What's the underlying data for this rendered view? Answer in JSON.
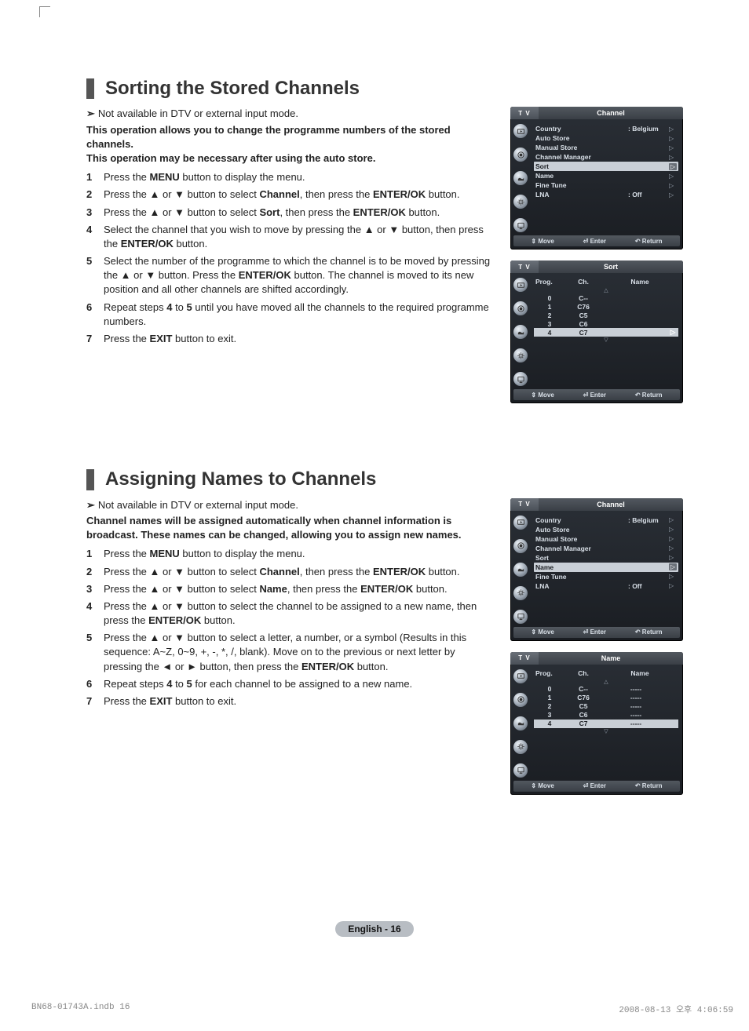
{
  "page": {
    "lang_badge": "English - 16",
    "doc_file": "BN68-01743A.indb   16",
    "doc_timestamp": "2008-08-13   오후 4:06:59"
  },
  "glyph": {
    "up": "▲",
    "down": "▼",
    "left": "◄",
    "right": "►",
    "tri_r": "▷",
    "tri_u": "△",
    "tri_d": "▽",
    "updown": "⇕",
    "enter": "⏎",
    "return": "↶",
    "note_arrow": "➢"
  },
  "section1": {
    "heading": "Sorting the Stored Channels",
    "note": "Not available in DTV or external input mode.",
    "intro1": "This operation allows you to change the programme numbers of the stored channels.",
    "intro2": "This operation may be necessary after using the auto store.",
    "steps": [
      {
        "n": "1",
        "parts": [
          "Press the ",
          {
            "b": "MENU"
          },
          " button to display the menu."
        ]
      },
      {
        "n": "2",
        "parts": [
          "Press the ▲ or ▼ button to select ",
          {
            "b": "Channel"
          },
          ", then press the ",
          {
            "b": "ENTER/OK"
          },
          " button."
        ]
      },
      {
        "n": "3",
        "parts": [
          "Press the ▲ or ▼ button to select ",
          {
            "b": "Sort"
          },
          ", then press the ",
          {
            "b": "ENTER/OK"
          },
          " button."
        ]
      },
      {
        "n": "4",
        "parts": [
          "Select the channel that you wish to move by pressing the ▲ or ▼ button, then press the ",
          {
            "b": "ENTER/OK"
          },
          " button."
        ]
      },
      {
        "n": "5",
        "parts": [
          "Select the number of the programme to which the channel is to be moved by pressing the ▲ or ▼ button. Press the ",
          {
            "b": "ENTER/OK"
          },
          " button. The channel is moved to its new position and all other channels are shifted accordingly."
        ]
      },
      {
        "n": "6",
        "parts": [
          "Repeat steps ",
          {
            "b": "4"
          },
          " to ",
          {
            "b": "5"
          },
          " until you have moved all the channels to the required programme numbers."
        ]
      },
      {
        "n": "7",
        "parts": [
          "Press the ",
          {
            "b": "EXIT"
          },
          " button to exit."
        ]
      }
    ]
  },
  "section2": {
    "heading": "Assigning Names to Channels",
    "note": "Not available in DTV or external input mode.",
    "intro1": "Channel names will be assigned automatically when channel information is broadcast. These names can be changed, allowing you to assign new names.",
    "steps": [
      {
        "n": "1",
        "parts": [
          "Press the ",
          {
            "b": "MENU"
          },
          " button to display the menu."
        ]
      },
      {
        "n": "2",
        "parts": [
          "Press the ▲ or ▼ button to select ",
          {
            "b": "Channel"
          },
          ", then press the ",
          {
            "b": "ENTER/OK"
          },
          " button."
        ]
      },
      {
        "n": "3",
        "parts": [
          "Press the ▲ or ▼ button to select ",
          {
            "b": "Name"
          },
          ", then press the ",
          {
            "b": "ENTER/OK"
          },
          " button."
        ]
      },
      {
        "n": "4",
        "parts": [
          "Press the ▲ or ▼ button to select the channel to be assigned to a new name, then press the ",
          {
            "b": "ENTER/OK"
          },
          " button."
        ]
      },
      {
        "n": "5",
        "parts": [
          "Press the ▲ or ▼ button to select a letter, a number, or a symbol (Results in this sequence: A~Z, 0~9, +, -, *, /, blank). Move on to the previous or next letter by pressing the ◄ or ► button, then press the ",
          {
            "b": "ENTER/OK"
          },
          " button."
        ]
      },
      {
        "n": "6",
        "parts": [
          "Repeat steps ",
          {
            "b": "4"
          },
          " to ",
          {
            "b": "5"
          },
          " for each channel to be assigned to a new name."
        ]
      },
      {
        "n": "7",
        "parts": [
          "Press the ",
          {
            "b": "EXIT"
          },
          " button to exit."
        ]
      }
    ]
  },
  "osd": {
    "tab": "T V",
    "foot_move": "Move",
    "foot_enter": "Enter",
    "foot_return": "Return",
    "channel_menu": {
      "title": "Channel",
      "items": [
        {
          "label": "Country",
          "val": ": Belgium"
        },
        {
          "label": "Auto Store",
          "val": ""
        },
        {
          "label": "Manual Store",
          "val": ""
        },
        {
          "label": "Channel Manager",
          "val": ""
        },
        {
          "label": "Sort",
          "val": ""
        },
        {
          "label": "Name",
          "val": ""
        },
        {
          "label": "Fine Tune",
          "val": ""
        },
        {
          "label": "LNA",
          "val": ": Off"
        }
      ],
      "selected_sort_idx": 4,
      "selected_name_idx": 5
    },
    "sort_screen": {
      "title": "Sort",
      "cols": {
        "c1": "Prog.",
        "c2": "Ch.",
        "c3": "Name"
      },
      "rows": [
        {
          "prog": "0",
          "ch": "C--",
          "name": ""
        },
        {
          "prog": "1",
          "ch": "C76",
          "name": ""
        },
        {
          "prog": "2",
          "ch": "C5",
          "name": ""
        },
        {
          "prog": "3",
          "ch": "C6",
          "name": ""
        },
        {
          "prog": "4",
          "ch": "C7",
          "name": ""
        }
      ],
      "selected_idx": 4
    },
    "name_screen": {
      "title": "Name",
      "cols": {
        "c1": "Prog.",
        "c2": "Ch.",
        "c3": "Name"
      },
      "rows": [
        {
          "prog": "0",
          "ch": "C--",
          "name": "-----"
        },
        {
          "prog": "1",
          "ch": "C76",
          "name": "-----"
        },
        {
          "prog": "2",
          "ch": "C5",
          "name": "-----"
        },
        {
          "prog": "3",
          "ch": "C6",
          "name": "-----"
        },
        {
          "prog": "4",
          "ch": "C7",
          "name": "-----"
        }
      ],
      "selected_idx": 4
    }
  }
}
